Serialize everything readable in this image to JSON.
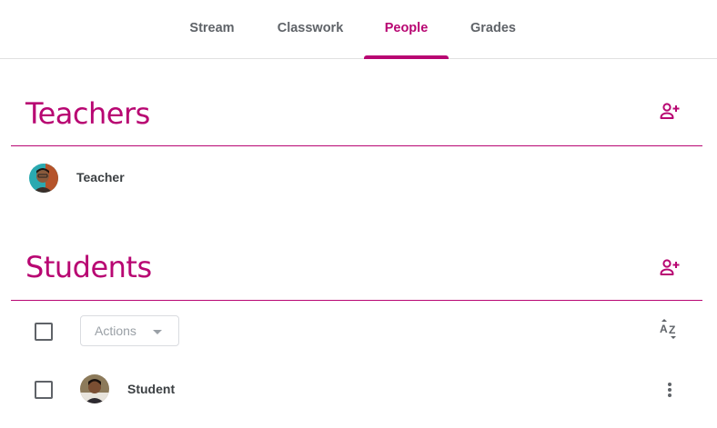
{
  "nav": {
    "tabs": [
      {
        "label": "Stream"
      },
      {
        "label": "Classwork"
      },
      {
        "label": "People"
      },
      {
        "label": "Grades"
      }
    ],
    "active": "People"
  },
  "teachers": {
    "title": "Teachers",
    "add_icon": "person-add-icon",
    "people": [
      {
        "name": "Teacher"
      }
    ]
  },
  "students": {
    "title": "Students",
    "add_icon": "person-add-icon",
    "actions_label": "Actions",
    "sort_icon": "sort-az-icon",
    "people": [
      {
        "name": "Student"
      }
    ]
  },
  "colors": {
    "accent": "#b80672",
    "text": "#3c4043",
    "muted": "#5f6368"
  }
}
